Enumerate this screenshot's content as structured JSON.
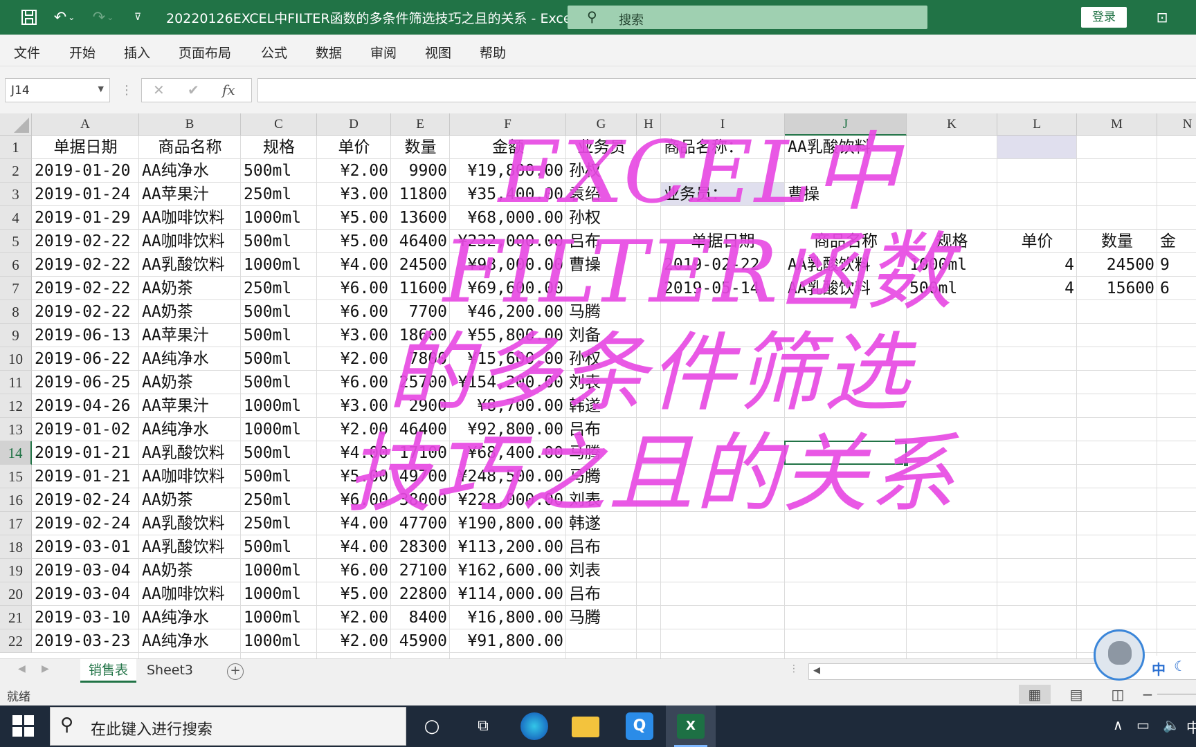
{
  "window": {
    "title": "20220126EXCEL中FILTER函数的多条件筛选技巧之且的关系  -  Excel",
    "search_placeholder": "搜索",
    "login_label": "登录"
  },
  "menu": [
    "文件",
    "开始",
    "插入",
    "页面布局",
    "公式",
    "数据",
    "审阅",
    "视图",
    "帮助"
  ],
  "formula_bar": {
    "name_box": "J14",
    "formula": ""
  },
  "columns": [
    "A",
    "B",
    "C",
    "D",
    "E",
    "F",
    "G",
    "H",
    "I",
    "J",
    "K",
    "L",
    "M",
    "N"
  ],
  "rows": [
    "1",
    "2",
    "3",
    "4",
    "5",
    "6",
    "7",
    "8",
    "9",
    "10",
    "11",
    "12",
    "13",
    "14",
    "15",
    "16",
    "17",
    "18",
    "19",
    "20",
    "21",
    "22"
  ],
  "table": {
    "headers": [
      "单据日期",
      "商品名称",
      "规格",
      "单价",
      "数量",
      "金额",
      "业务员"
    ],
    "rows": [
      [
        "2019-01-20",
        "AA纯净水",
        "500ml",
        "¥2.00",
        "9900",
        "¥19,800.00",
        "孙权"
      ],
      [
        "2019-01-24",
        "AA苹果汁",
        "250ml",
        "¥3.00",
        "11800",
        "¥35,400.00",
        "袁绍"
      ],
      [
        "2019-01-29",
        "AA咖啡饮料",
        "1000ml",
        "¥5.00",
        "13600",
        "¥68,000.00",
        "孙权"
      ],
      [
        "2019-02-22",
        "AA咖啡饮料",
        "500ml",
        "¥5.00",
        "46400",
        "¥232,000.00",
        "吕布"
      ],
      [
        "2019-02-22",
        "AA乳酸饮料",
        "1000ml",
        "¥4.00",
        "24500",
        "¥98,000.00",
        "曹操"
      ],
      [
        "2019-02-22",
        "AA奶茶",
        "250ml",
        "¥6.00",
        "11600",
        "¥69,600.00",
        ""
      ],
      [
        "2019-02-22",
        "AA奶茶",
        "500ml",
        "¥6.00",
        "7700",
        "¥46,200.00",
        "马腾"
      ],
      [
        "2019-06-13",
        "AA苹果汁",
        "500ml",
        "¥3.00",
        "18600",
        "¥55,800.00",
        "刘备"
      ],
      [
        "2019-06-22",
        "AA纯净水",
        "500ml",
        "¥2.00",
        "7800",
        "¥15,600.00",
        "孙权"
      ],
      [
        "2019-06-25",
        "AA奶茶",
        "500ml",
        "¥6.00",
        "25700",
        "¥154,200.00",
        "刘表"
      ],
      [
        "2019-04-26",
        "AA苹果汁",
        "1000ml",
        "¥3.00",
        "2900",
        "¥8,700.00",
        "韩遂"
      ],
      [
        "2019-01-02",
        "AA纯净水",
        "1000ml",
        "¥2.00",
        "46400",
        "¥92,800.00",
        "吕布"
      ],
      [
        "2019-01-21",
        "AA乳酸饮料",
        "500ml",
        "¥4.00",
        "17100",
        "¥68,400.00",
        "马腾"
      ],
      [
        "2019-01-21",
        "AA咖啡饮料",
        "500ml",
        "¥5.00",
        "49700",
        "¥248,500.00",
        "马腾"
      ],
      [
        "2019-02-24",
        "AA奶茶",
        "250ml",
        "¥6.00",
        "38000",
        "¥228,000.00",
        "刘表"
      ],
      [
        "2019-02-24",
        "AA乳酸饮料",
        "250ml",
        "¥4.00",
        "47700",
        "¥190,800.00",
        "韩遂"
      ],
      [
        "2019-03-01",
        "AA乳酸饮料",
        "500ml",
        "¥4.00",
        "28300",
        "¥113,200.00",
        "吕布"
      ],
      [
        "2019-03-04",
        "AA奶茶",
        "1000ml",
        "¥6.00",
        "27100",
        "¥162,600.00",
        "刘表"
      ],
      [
        "2019-03-04",
        "AA咖啡饮料",
        "1000ml",
        "¥5.00",
        "22800",
        "¥114,000.00",
        "吕布"
      ],
      [
        "2019-03-10",
        "AA纯净水",
        "1000ml",
        "¥2.00",
        "8400",
        "¥16,800.00",
        "马腾"
      ],
      [
        "2019-03-23",
        "AA纯净水",
        "1000ml",
        "¥2.00",
        "45900",
        "¥91,800.00",
        ""
      ]
    ]
  },
  "criteria": {
    "product_label": "商品名称：",
    "product_value": "AA乳酸饮料",
    "salesperson_label": "业务员：",
    "salesperson_value": "曹操"
  },
  "result": {
    "headers": [
      "单据日期",
      "商品名称",
      "规格",
      "单价",
      "数量",
      "金"
    ],
    "rows": [
      [
        "2019-02-22",
        "AA乳酸饮料",
        "1000ml",
        "4",
        "24500",
        "9"
      ],
      [
        "2019-05-14",
        "AA乳酸饮料",
        "500ml",
        "4",
        "15600",
        "6"
      ]
    ]
  },
  "overlay_text": [
    "EXCEL中",
    "FILTER函数",
    "的多条件筛选",
    "技巧之且的关系"
  ],
  "sheet_tabs": [
    "销售表",
    "Sheet3"
  ],
  "status": "就绪",
  "taskbar": {
    "search_placeholder": "在此键入进行搜索"
  },
  "ime": "中",
  "accent_color": "#217346",
  "overlay_color": "#e84ae3"
}
